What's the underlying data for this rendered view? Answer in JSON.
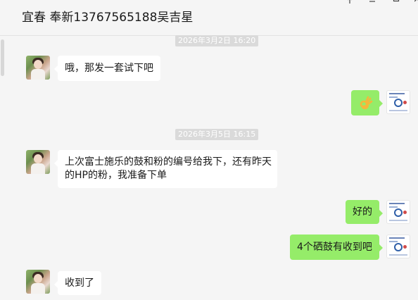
{
  "window": {
    "title": "宜春 奉新13767565188吴吉星",
    "controls": {
      "pin_icon": "pin-icon",
      "minimize_icon": "minimize-icon",
      "maximize_icon": "maximize-icon",
      "close_icon": "close-icon"
    }
  },
  "colors": {
    "outgoing_bubble": "#95ec69",
    "incoming_bubble": "#ffffff",
    "background": "#f5f5f5",
    "timestamp_bg": "#dadada"
  },
  "timestamps": [
    "2026年3月2日 16:20",
    "2026年3月5日 16:15"
  ],
  "messages": [
    {
      "direction": "in",
      "text": "哦，那发一套试下吧"
    },
    {
      "direction": "out",
      "type": "emoji",
      "emoji": "ok-hand-emoji"
    },
    {
      "direction": "in",
      "text_line1": "上次富士施乐的鼓和粉的编号给我下，还有昨天",
      "text_line2": "的HP的粉，我准备下单"
    },
    {
      "direction": "out",
      "text": "好的"
    },
    {
      "direction": "out",
      "text": "4个硒鼓有收到吧"
    },
    {
      "direction": "in",
      "text": "收到了"
    }
  ]
}
